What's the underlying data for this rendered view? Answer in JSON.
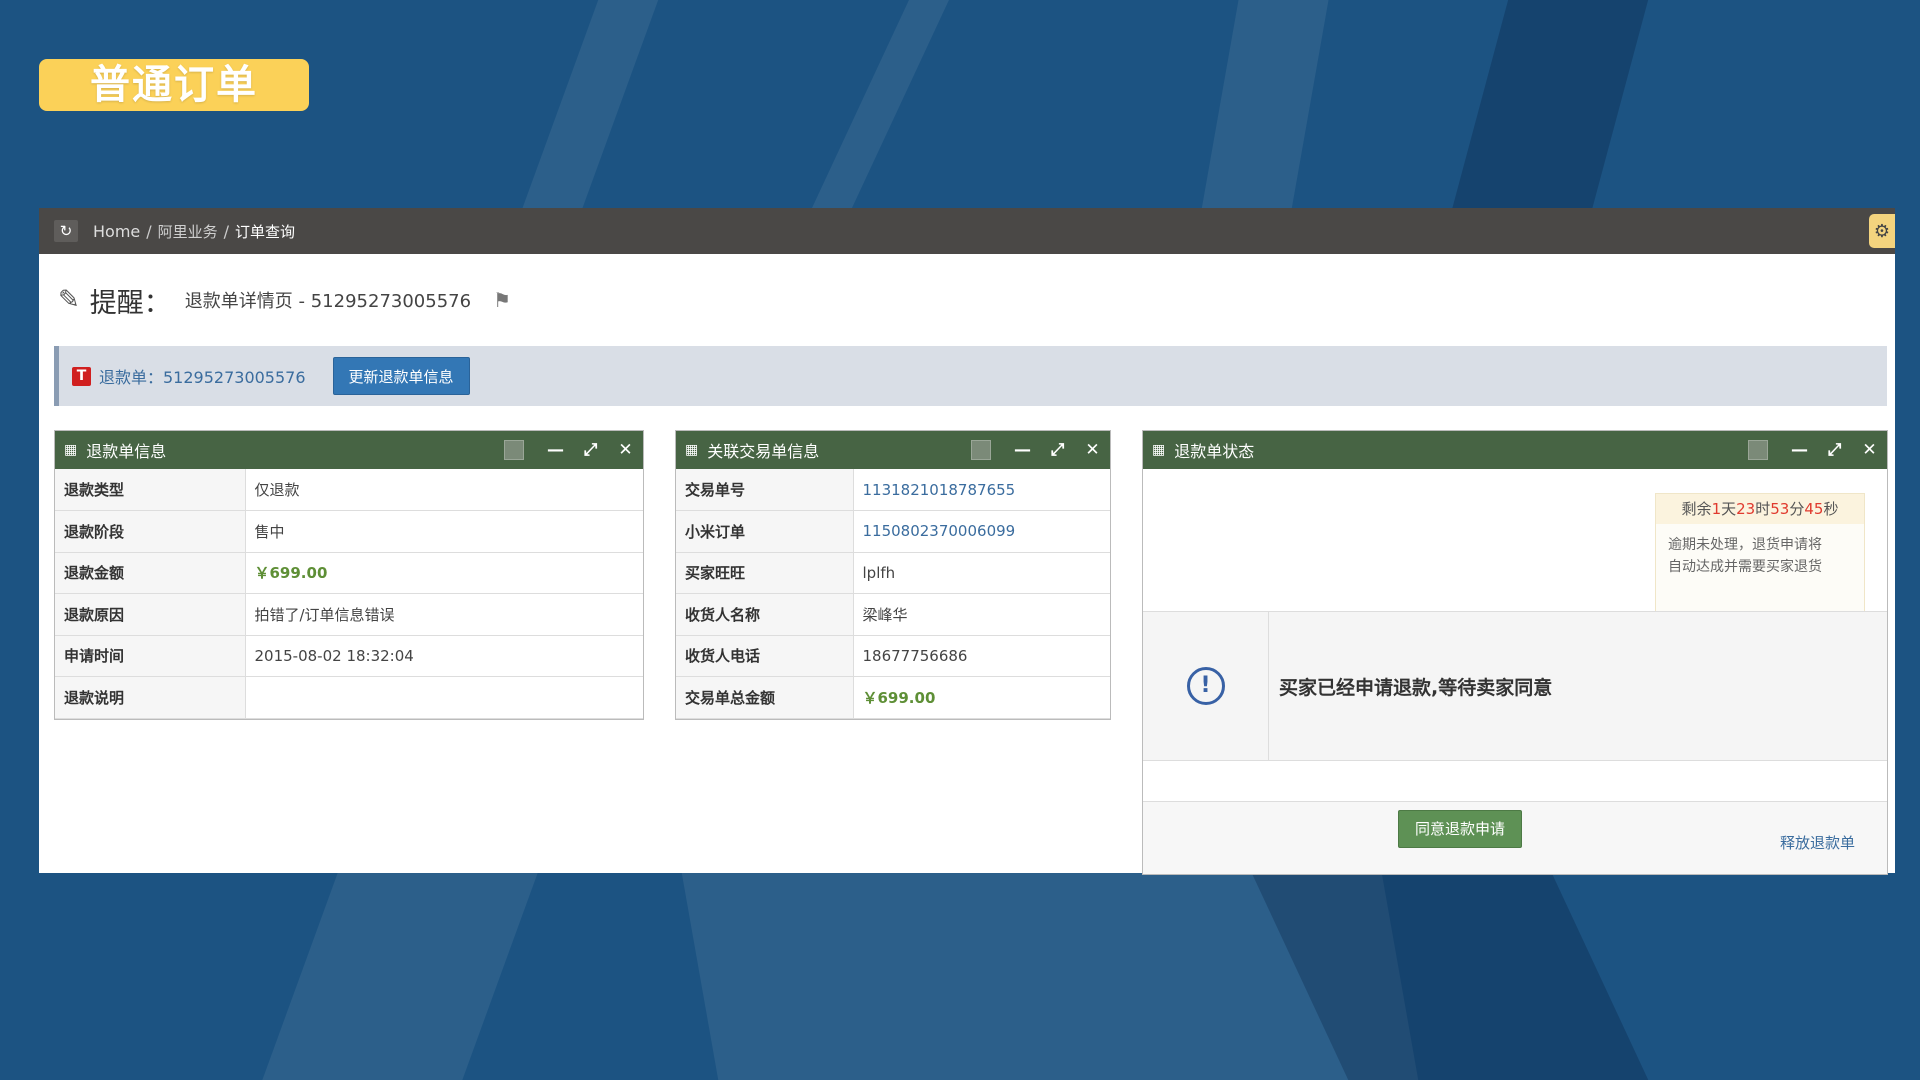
{
  "slide_title": "普通订单",
  "breadcrumb": {
    "home": "Home",
    "sep": "/",
    "level2": "阿里业务",
    "level3": "订单查询"
  },
  "reminder": {
    "label": "提醒：",
    "detail": "退款单详情页 - 51295273005576"
  },
  "alert": {
    "refund_label": "退款单：51295273005576",
    "update_button": "更新退款单信息"
  },
  "refund_info": {
    "title": "退款单信息",
    "rows": [
      {
        "key": "退款类型",
        "value": "仅退款"
      },
      {
        "key": "退款阶段",
        "value": "售中"
      },
      {
        "key": "退款金额",
        "value": "￥699.00"
      },
      {
        "key": "退款原因",
        "value": "拍错了/订单信息错误"
      },
      {
        "key": "申请时间",
        "value": "2015-08-02 18:32:04"
      },
      {
        "key": "退款说明",
        "value": ""
      }
    ]
  },
  "trade_info": {
    "title": "关联交易单信息",
    "rows": [
      {
        "key": "交易单号",
        "value": "1131821018787655"
      },
      {
        "key": "小米订单",
        "value": "1150802370006099"
      },
      {
        "key": "买家旺旺",
        "value": "lplfh"
      },
      {
        "key": "收货人名称",
        "value": "梁峰华"
      },
      {
        "key": "收货人电话",
        "value": "18677756686"
      },
      {
        "key": "交易单总金额",
        "value": "￥699.00"
      }
    ]
  },
  "status": {
    "title": "退款单状态",
    "countdown": {
      "prefix": "剩余",
      "days": "1",
      "days_unit": "天",
      "hours": "23",
      "hours_unit": "时",
      "minutes": "53",
      "minutes_unit": "分",
      "seconds": "45",
      "seconds_unit": "秒"
    },
    "notice_line1": "逾期未处理，退货申请将",
    "notice_line2": "自动达成并需要买家退货",
    "message": "买家已经申请退款,等待卖家同意",
    "agree_button": "同意退款申请",
    "release_link": "释放退款单"
  }
}
